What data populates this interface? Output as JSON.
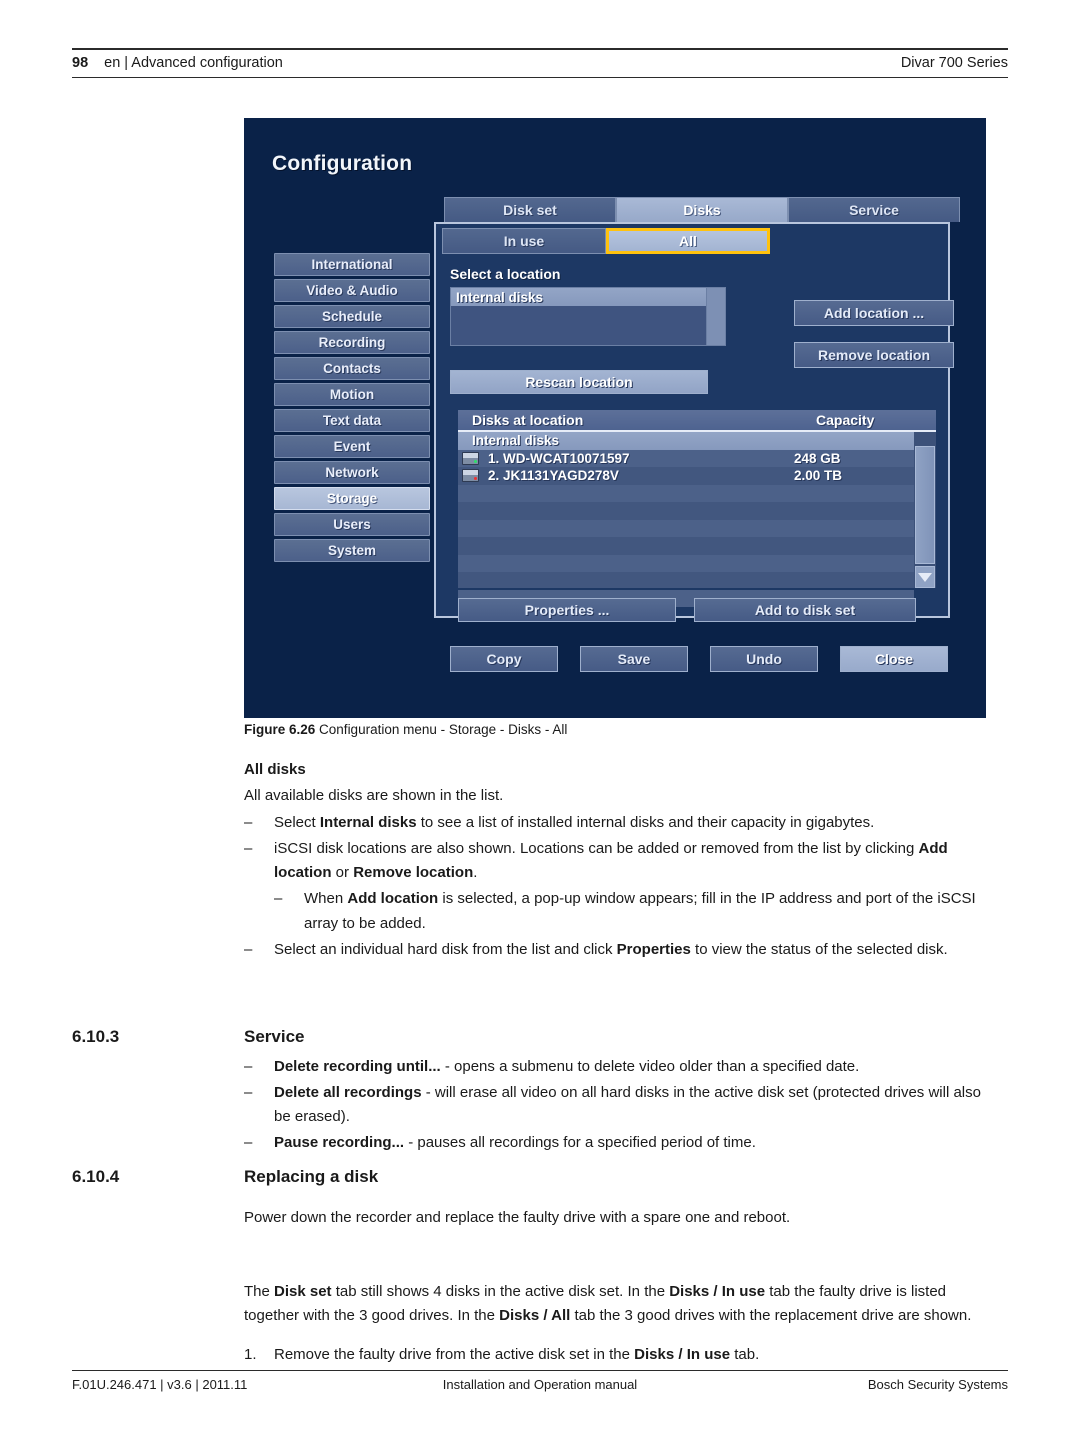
{
  "header": {
    "page_number": "98",
    "left": "en | Advanced configuration",
    "right": "Divar 700 Series"
  },
  "screenshot": {
    "title": "Configuration",
    "sidebar": [
      {
        "label": "International",
        "selected": false
      },
      {
        "label": "Video & Audio",
        "selected": false
      },
      {
        "label": "Schedule",
        "selected": false
      },
      {
        "label": "Recording",
        "selected": false
      },
      {
        "label": "Contacts",
        "selected": false
      },
      {
        "label": "Motion",
        "selected": false
      },
      {
        "label": "Text data",
        "selected": false
      },
      {
        "label": "Event",
        "selected": false
      },
      {
        "label": "Network",
        "selected": false
      },
      {
        "label": "Storage",
        "selected": true
      },
      {
        "label": "Users",
        "selected": false
      },
      {
        "label": "System",
        "selected": false
      }
    ],
    "tabs_top": [
      {
        "label": "Disk set",
        "active": false
      },
      {
        "label": "Disks",
        "active": true
      },
      {
        "label": "Service",
        "active": false
      }
    ],
    "tabs_sub": [
      {
        "label": "In use",
        "active": false
      },
      {
        "label": "All",
        "active": true
      }
    ],
    "focus_color": "#ffc20e",
    "select_location_label": "Select a location",
    "location_list": [
      {
        "label": "Internal disks",
        "selected": true
      },
      {
        "label": "",
        "selected": false
      },
      {
        "label": "",
        "selected": false
      }
    ],
    "buttons": {
      "rescan_location": "Rescan location",
      "add_location": "Add location ...",
      "remove_location": "Remove location",
      "properties": "Properties ...",
      "add_to_disk_set": "Add to disk set"
    },
    "disks_table": {
      "columns": [
        "Disks at location",
        "Capacity"
      ],
      "group_label": "Internal disks",
      "rows": [
        {
          "name": "1. WD-WCAT10071597",
          "capacity": "248 GB",
          "led": "green"
        },
        {
          "name": "2. JK1131YAGD278V",
          "capacity": "2.00 TB",
          "led": "red"
        }
      ]
    },
    "footer_buttons": [
      {
        "label": "Copy",
        "highlighted": false
      },
      {
        "label": "Save",
        "highlighted": false
      },
      {
        "label": "Undo",
        "highlighted": false
      },
      {
        "label": "Close",
        "highlighted": true
      }
    ]
  },
  "figure": {
    "number": "Figure  6.26",
    "caption": "Configuration menu - Storage - Disks - All"
  },
  "all_disks": {
    "heading": "All disks",
    "intro": "All available disks are shown in the list.",
    "bullet1_pre": "Select ",
    "bullet1_b": "Internal disks",
    "bullet1_post": " to see a list of installed internal disks and their capacity in gigabytes.",
    "bullet2_pre": "iSCSI disk locations are also shown. Locations can be added or removed from the list by clicking ",
    "bullet2_b1": "Add location",
    "bullet2_mid": " or ",
    "bullet2_b2": "Remove location",
    "bullet2_post": ".",
    "bullet2_sub_pre": "When ",
    "bullet2_sub_b": "Add location",
    "bullet2_sub_post": " is selected, a pop-up window appears; fill in the IP address and port of the iSCSI array to be added.",
    "bullet3_pre": "Select an individual hard disk from the list and click ",
    "bullet3_b": "Properties",
    "bullet3_post": " to view the status of the selected disk."
  },
  "service_section": {
    "number": "6.10.3",
    "title": "Service",
    "items": [
      {
        "bold": "Delete recording until...",
        "rest": " - opens a submenu to delete video older than a specified date."
      },
      {
        "bold": "Delete all recordings",
        "rest": " - will erase all video on all hard disks in the active disk set (protected drives will also be erased)."
      },
      {
        "bold": "Pause recording...",
        "rest": " - pauses all recordings for a specified period of time."
      }
    ]
  },
  "replacing_section": {
    "number": "6.10.4",
    "title": "Replacing a disk",
    "para1": "Power down the recorder and replace the faulty drive with a spare one and reboot.",
    "para2_p1": "The ",
    "para2_b1": "Disk set",
    "para2_p2": " tab still shows 4 disks in the active disk set. In the ",
    "para2_b2": "Disks / In use",
    "para2_p3": " tab the faulty drive is listed together with the 3 good drives. In the ",
    "para2_b3": "Disks / All",
    "para2_p4": " tab the 3 good drives with the replacement drive are shown.",
    "step1_num": "1.",
    "step1_p1": "Remove the faulty drive from the active disk set in the ",
    "step1_b1": "Disks / In use",
    "step1_p2": " tab."
  },
  "footer": {
    "left": "F.01U.246.471 | v3.6 | 2011.11",
    "center": "Installation and Operation manual",
    "right": "Bosch Security Systems"
  }
}
